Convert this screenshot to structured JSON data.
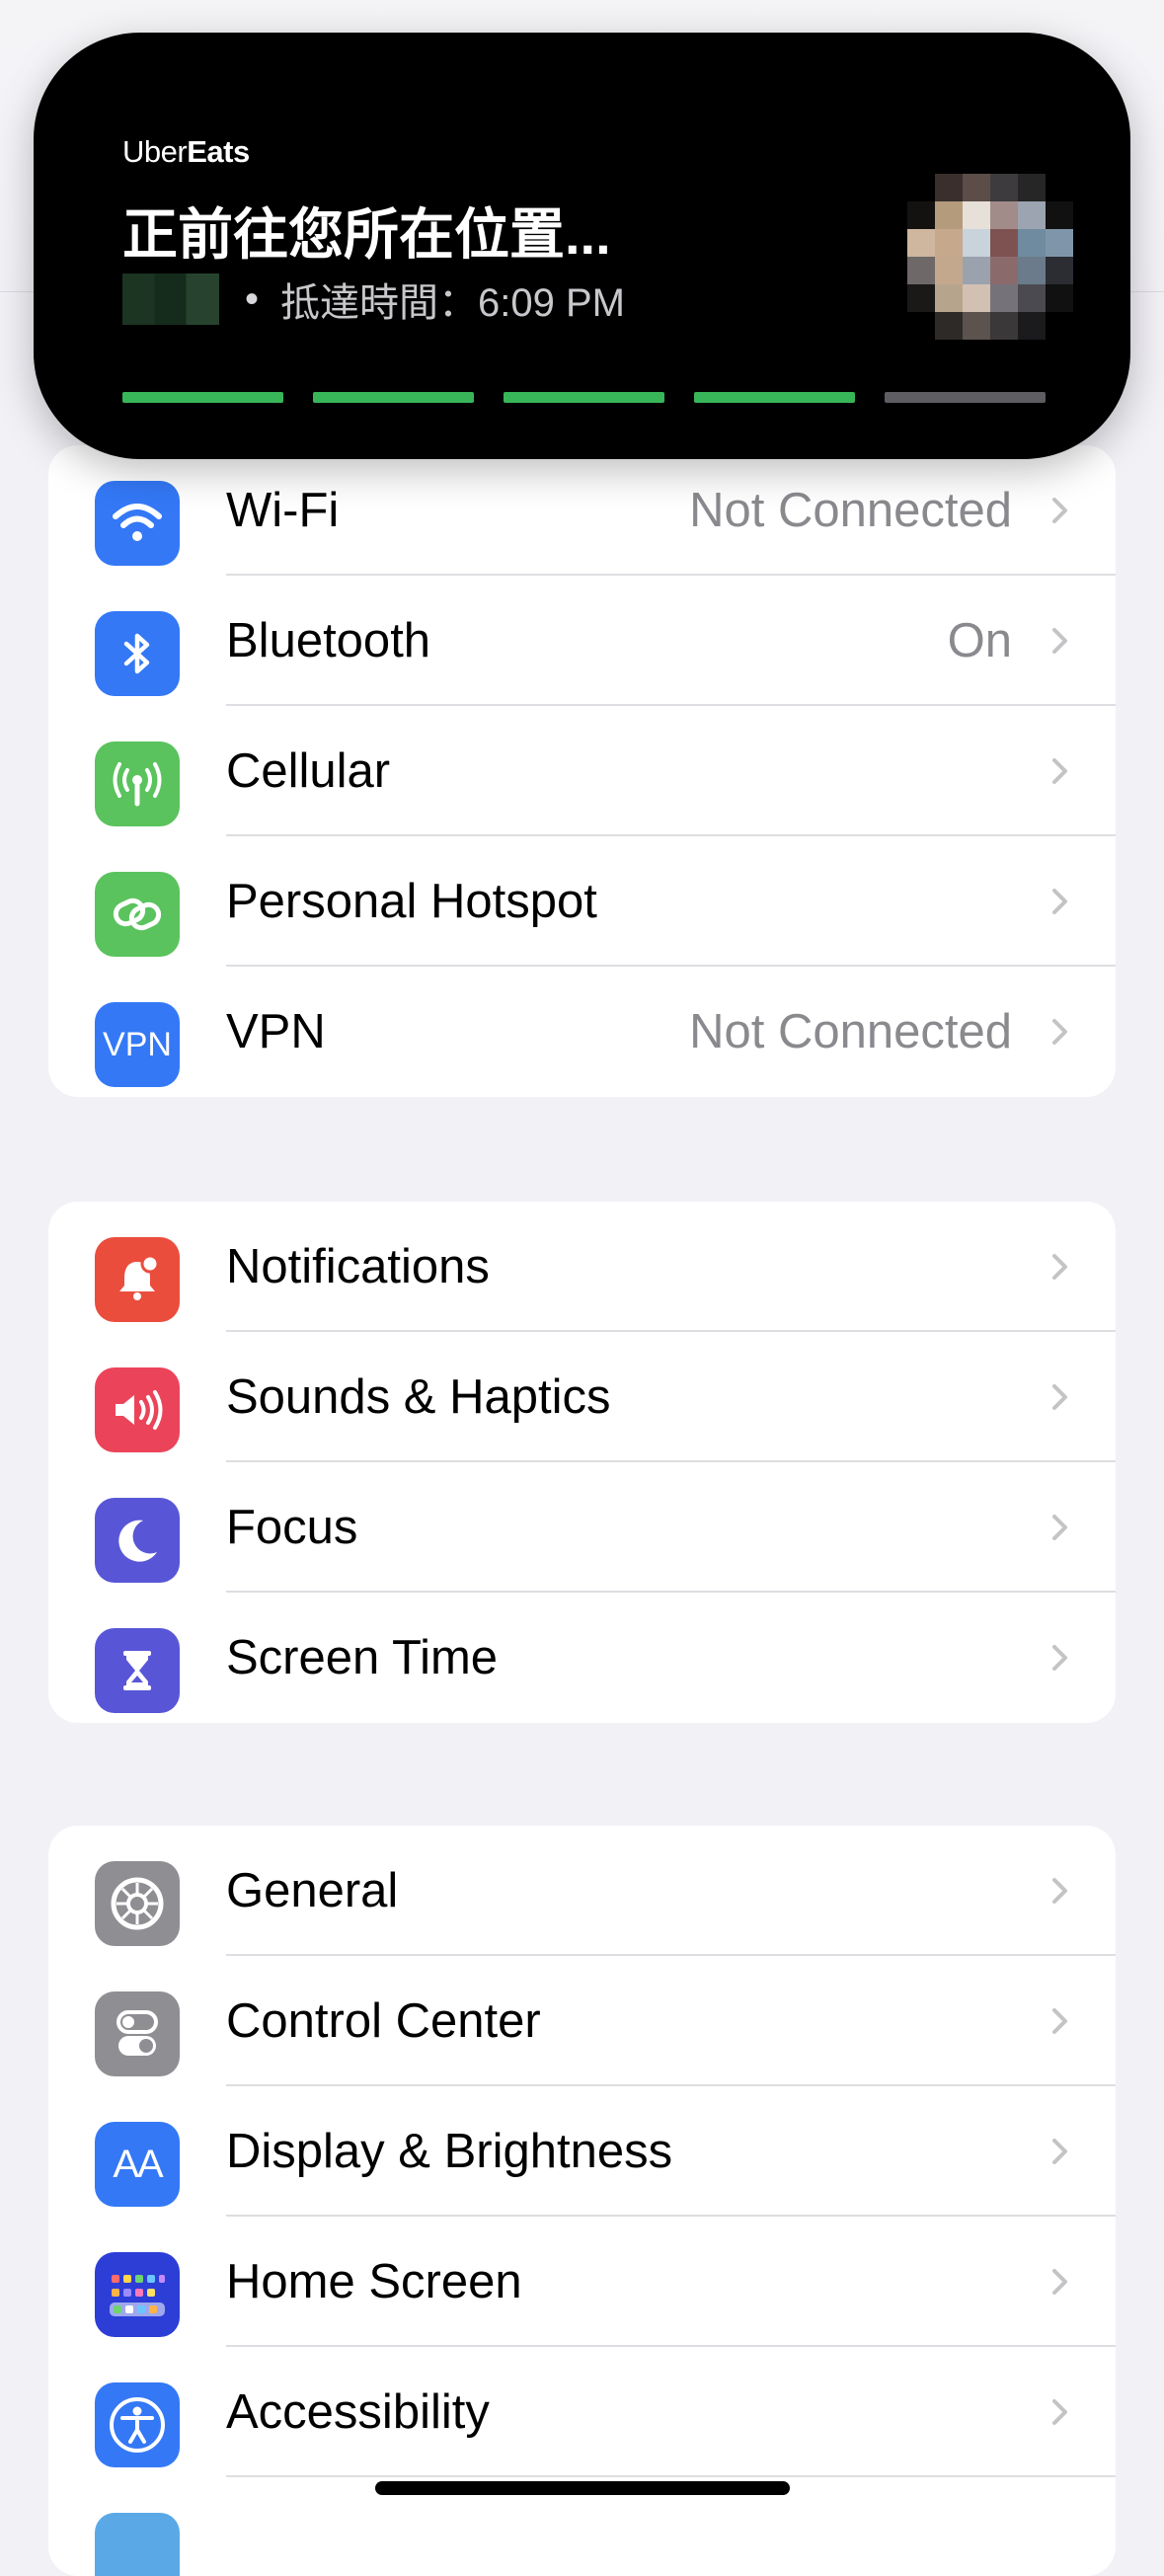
{
  "live_activity": {
    "app_name_light": "Uber",
    "app_name_bold": "Eats",
    "headline": "正前往您所在位置...",
    "bullet": "•",
    "arrival": "抵達時間：6:09 PM",
    "progress": {
      "segments_total": 5,
      "segments_complete": 4
    }
  },
  "groups": [
    {
      "rows": [
        {
          "label": "Wi-Fi",
          "value": "Not Connected",
          "icon": "wifi-icon",
          "color": "#3478f6"
        },
        {
          "label": "Bluetooth",
          "value": "On",
          "icon": "bluetooth-icon",
          "color": "#3478f6"
        },
        {
          "label": "Cellular",
          "value": "",
          "icon": "antenna-icon",
          "color": "#5ac35d"
        },
        {
          "label": "Personal Hotspot",
          "value": "",
          "icon": "hotspot-link-icon",
          "color": "#5ac35d"
        },
        {
          "label": "VPN",
          "value": "Not Connected",
          "icon": "vpn-icon",
          "icon_text": "VPN",
          "color": "#3478f6"
        }
      ]
    },
    {
      "rows": [
        {
          "label": "Notifications",
          "value": "",
          "icon": "bell-icon",
          "color": "#eb4d3d"
        },
        {
          "label": "Sounds & Haptics",
          "value": "",
          "icon": "speaker-icon",
          "color": "#eb445a"
        },
        {
          "label": "Focus",
          "value": "",
          "icon": "moon-icon",
          "color": "#5856d6"
        },
        {
          "label": "Screen Time",
          "value": "",
          "icon": "hourglass-icon",
          "color": "#5856d6"
        }
      ]
    },
    {
      "rows": [
        {
          "label": "General",
          "value": "",
          "icon": "gear-icon",
          "color": "#8e8e93"
        },
        {
          "label": "Control Center",
          "value": "",
          "icon": "toggles-icon",
          "color": "#8e8e93"
        },
        {
          "label": "Display & Brightness",
          "value": "",
          "icon": "text-size-icon",
          "icon_text": "AA",
          "color": "#3478f6"
        },
        {
          "label": "Home Screen",
          "value": "",
          "icon": "home-grid-icon",
          "color": "#2c3ed6"
        },
        {
          "label": "Accessibility",
          "value": "",
          "icon": "accessibility-icon",
          "color": "#3478f6"
        }
      ]
    }
  ]
}
